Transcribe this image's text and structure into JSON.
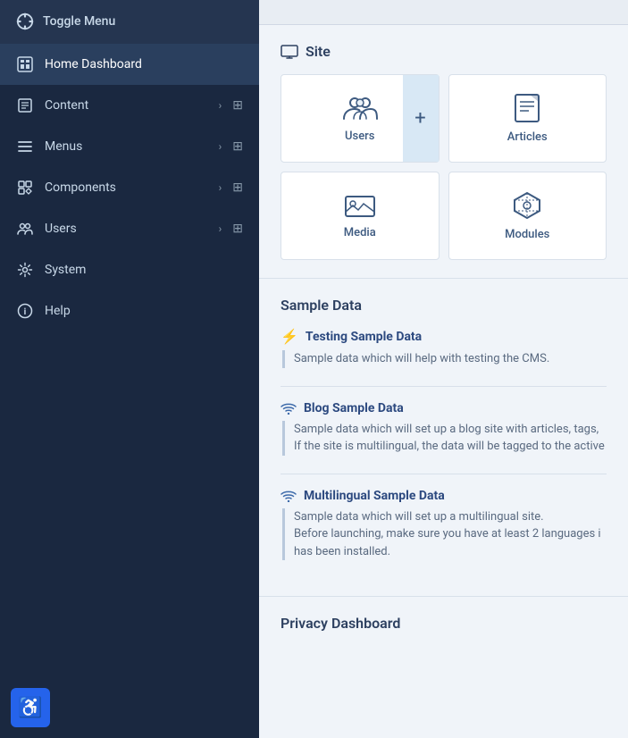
{
  "sidebar": {
    "toggle_label": "Toggle Menu",
    "items": [
      {
        "id": "home",
        "label": "Home Dashboard",
        "icon": "home-icon",
        "active": true,
        "has_arrow": false,
        "has_grid": false
      },
      {
        "id": "content",
        "label": "Content",
        "icon": "content-icon",
        "active": false,
        "has_arrow": true,
        "has_grid": true
      },
      {
        "id": "menus",
        "label": "Menus",
        "icon": "menus-icon",
        "active": false,
        "has_arrow": true,
        "has_grid": true
      },
      {
        "id": "components",
        "label": "Components",
        "icon": "components-icon",
        "active": false,
        "has_arrow": true,
        "has_grid": true
      },
      {
        "id": "users",
        "label": "Users",
        "icon": "users-icon",
        "active": false,
        "has_arrow": true,
        "has_grid": true
      },
      {
        "id": "system",
        "label": "System",
        "icon": "system-icon",
        "active": false,
        "has_arrow": false,
        "has_grid": false
      },
      {
        "id": "help",
        "label": "Help",
        "icon": "help-icon",
        "active": false,
        "has_arrow": false,
        "has_grid": false
      }
    ]
  },
  "main": {
    "site_section": {
      "title": "Site",
      "cards": [
        {
          "id": "users-card",
          "label": "Users",
          "icon": "users-card-icon"
        },
        {
          "id": "add-card",
          "label": "",
          "icon": "add-icon"
        },
        {
          "id": "articles-card",
          "label": "Articles",
          "icon": "articles-card-icon"
        },
        {
          "id": "media-card",
          "label": "Media",
          "icon": "media-card-icon"
        },
        {
          "id": "modules-card",
          "label": "Modules",
          "icon": "modules-card-icon"
        }
      ]
    },
    "sample_section": {
      "title": "Sample Data",
      "items": [
        {
          "id": "testing-sample",
          "icon": "bolt-icon",
          "title": "Testing Sample Data",
          "description": "Sample data which will help with testing the CMS."
        },
        {
          "id": "blog-sample",
          "icon": "wifi-icon",
          "title": "Blog Sample Data",
          "description": "Sample data which will set up a blog site with articles, tags,\nIf the site is multilingual, the data will be tagged to the active"
        },
        {
          "id": "multilingual-sample",
          "icon": "wifi-icon",
          "title": "Multilingual Sample Data",
          "description": "Sample data which will set up a multilingual site.\nBefore launching, make sure you have at least 2 languages i\nhas been installed."
        }
      ]
    },
    "privacy_section": {
      "title": "Privacy Dashboard"
    }
  },
  "accessibility": {
    "label": "♿"
  }
}
